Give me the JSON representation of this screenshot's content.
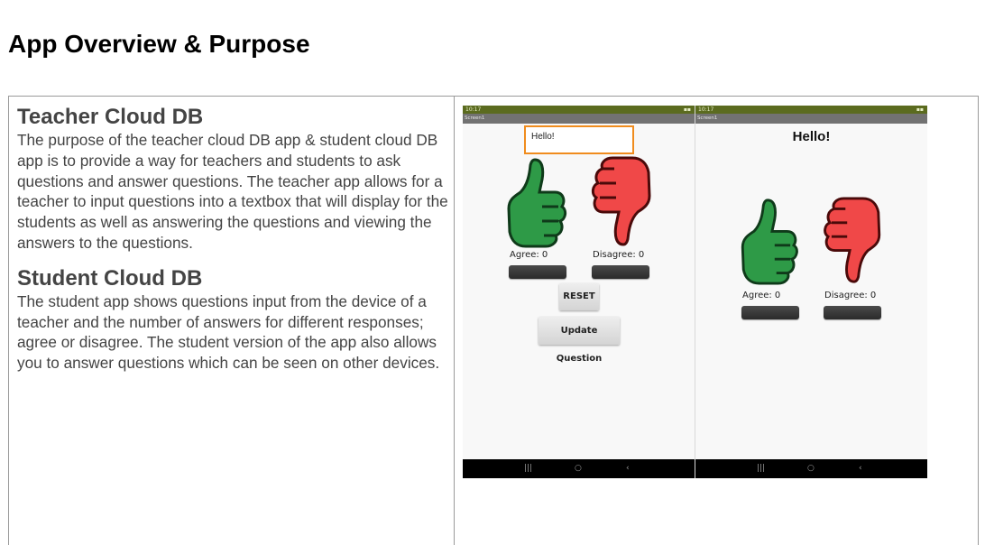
{
  "page": {
    "title": "App Overview & Purpose"
  },
  "sections": [
    {
      "heading": "Teacher Cloud DB",
      "body": "The purpose of the teacher cloud DB app & student cloud DB app is to provide a way for teachers and students to ask questions and answer questions. The teacher app allows for a teacher to input questions into a textbox that will display for the students as well as answering the questions and viewing the answers to the questions."
    },
    {
      "heading": "Student Cloud DB",
      "body": "The student app shows questions input from the device of a teacher and the number of answers for different responses; agree or disagree. The student version of the app also allows you to answer questions which can be seen on other devices."
    }
  ],
  "teacher_screen": {
    "status_time": "10:17",
    "screen_label": "Screen1",
    "question_value": "Hello!",
    "agree_label": "Agree: 0",
    "disagree_label": "Disagree: 0",
    "reset_label": "RESET",
    "update_label": "Update Question"
  },
  "student_screen": {
    "status_time": "10:17",
    "screen_label": "Screen1",
    "question_text": "Hello!",
    "agree_label": "Agree: 0",
    "disagree_label": "Disagree: 0"
  },
  "icons": {
    "thumbs_up": "thumbs-up-icon",
    "thumbs_down": "thumbs-down-icon",
    "nav_recents": "recents-icon",
    "nav_home": "home-icon",
    "nav_back": "back-icon"
  },
  "colors": {
    "status_bar": "#5b6b1f",
    "thumbs_up": "#2e9a47",
    "thumbs_down": "#f04848",
    "input_border": "#f08c1e"
  }
}
